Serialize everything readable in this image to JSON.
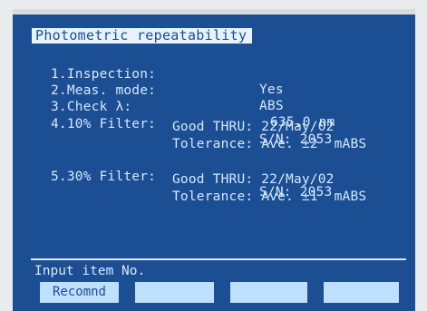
{
  "title": "Photometric repeatability",
  "items": [
    {
      "label": "1.Inspection:",
      "value": "Yes"
    },
    {
      "label": "2.Meas. mode:",
      "value": "ABS"
    },
    {
      "label": "3.Check λ:",
      "value": "635.0 nm"
    },
    {
      "label": "4.10% Filter:",
      "value": "S/N: 2053"
    },
    {
      "label": "5.30% Filter:",
      "value": "S/N: 2053"
    }
  ],
  "filter10": {
    "good_thru": "Good THRU: 22/May/02",
    "tolerance": "Tolerance: Ave. ±2  mABS"
  },
  "filter30": {
    "good_thru": "Good THRU: 22/May/02",
    "tolerance": "Tolerance: Ave. ±1  mABS"
  },
  "prompt": "Input item No.",
  "softkeys": [
    {
      "label": "Recomnd"
    },
    {
      "label": ""
    },
    {
      "label": ""
    },
    {
      "label": ""
    }
  ],
  "colors": {
    "screen_bg": "#1b4e93",
    "text": "#d6e8ff",
    "softkey_bg": "#bfe0ff"
  }
}
